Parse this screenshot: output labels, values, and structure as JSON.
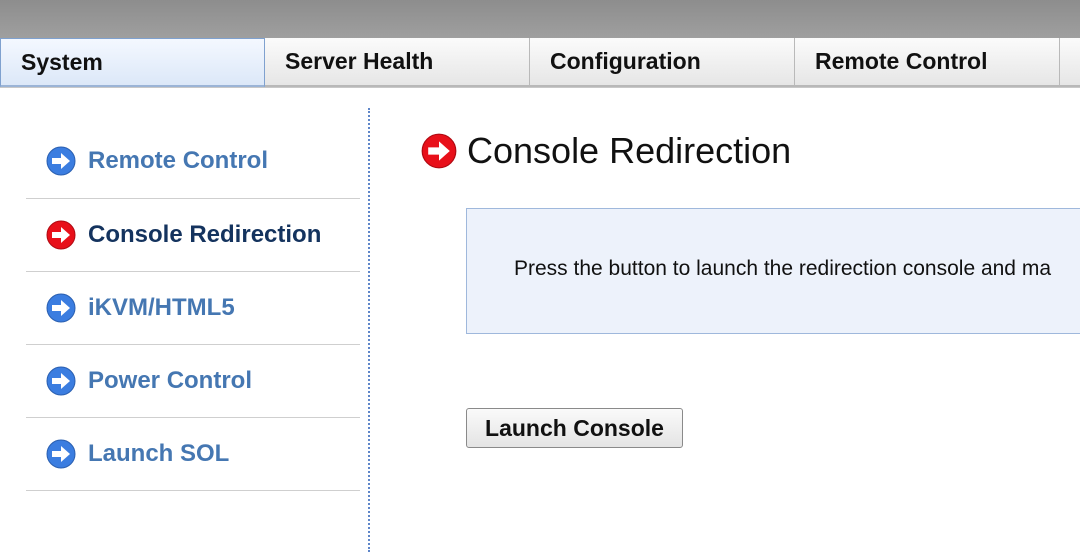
{
  "tabs": [
    {
      "label": "System",
      "active": true
    },
    {
      "label": "Server Health",
      "active": false
    },
    {
      "label": "Configuration",
      "active": false
    },
    {
      "label": "Remote Control",
      "active": false
    }
  ],
  "sidebar": {
    "items": [
      {
        "label": "Remote Control",
        "active": false,
        "icon": "blue-arrow-icon"
      },
      {
        "label": "Console Redirection",
        "active": true,
        "icon": "red-arrow-icon"
      },
      {
        "label": "iKVM/HTML5",
        "active": false,
        "icon": "blue-arrow-icon"
      },
      {
        "label": "Power Control",
        "active": false,
        "icon": "blue-arrow-icon"
      },
      {
        "label": "Launch SOL",
        "active": false,
        "icon": "blue-arrow-icon"
      }
    ]
  },
  "main": {
    "title": "Console Redirection",
    "title_icon": "red-arrow-icon",
    "info_text": "Press the button to launch the redirection console and ma",
    "launch_button_label": "Launch Console"
  },
  "colors": {
    "active_arrow": "#e8101a",
    "inactive_arrow": "#3b7de0",
    "link_text": "#4577b2",
    "active_link_text": "#14335e",
    "info_background": "#edf2fb"
  }
}
